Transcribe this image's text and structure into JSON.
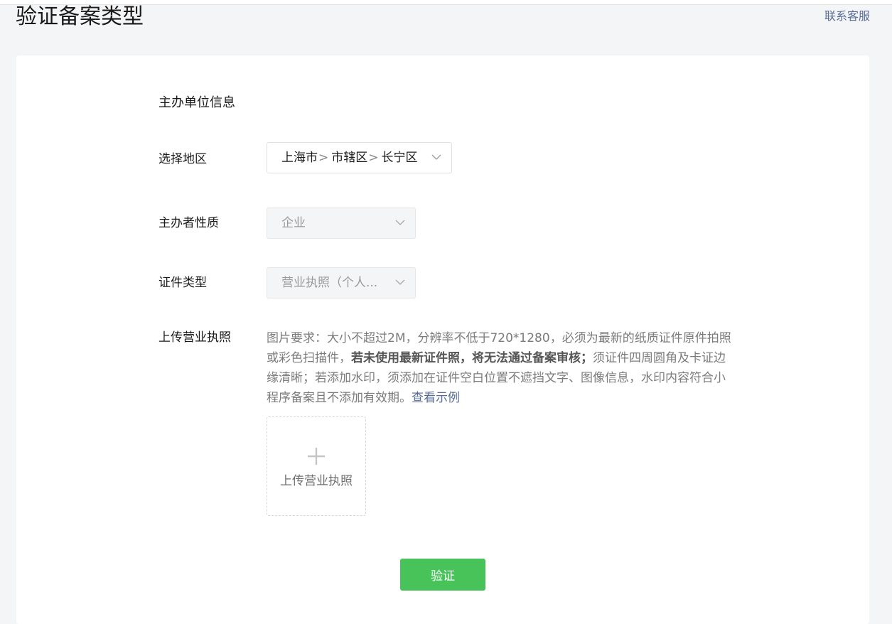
{
  "header": {
    "title": "验证备案类型",
    "contact_label": "联系客服"
  },
  "form": {
    "section_title": "主办单位信息",
    "region": {
      "label": "选择地区",
      "province": "上海市",
      "city": "市辖区",
      "district": "长宁区",
      "separator": ">"
    },
    "organizer_type": {
      "label": "主办者性质",
      "value": "企业"
    },
    "certificate_type": {
      "label": "证件类型",
      "value": "营业执照（个人..."
    },
    "upload": {
      "label": "上传营业执照",
      "requirements_prefix": "图片要求：大小不超过2M，分辨率不低于720*1280，必须为最新的纸质证件原件拍照或彩色扫描件，",
      "requirements_bold": "若未使用最新证件照，将无法通过备案审核；",
      "requirements_suffix": "须证件四周圆角及卡证边缘清晰；若添加水印，须添加在证件空白位置不遮挡文字、图像信息，水印内容符合小程序备案且不添加有效期。",
      "example_link": "查看示例",
      "button_label": "上传营业执照",
      "icon": "plus-icon"
    },
    "submit_label": "验证"
  },
  "colors": {
    "primary_button": "#47c359",
    "link": "#576b95",
    "background": "#f4f5f7"
  }
}
